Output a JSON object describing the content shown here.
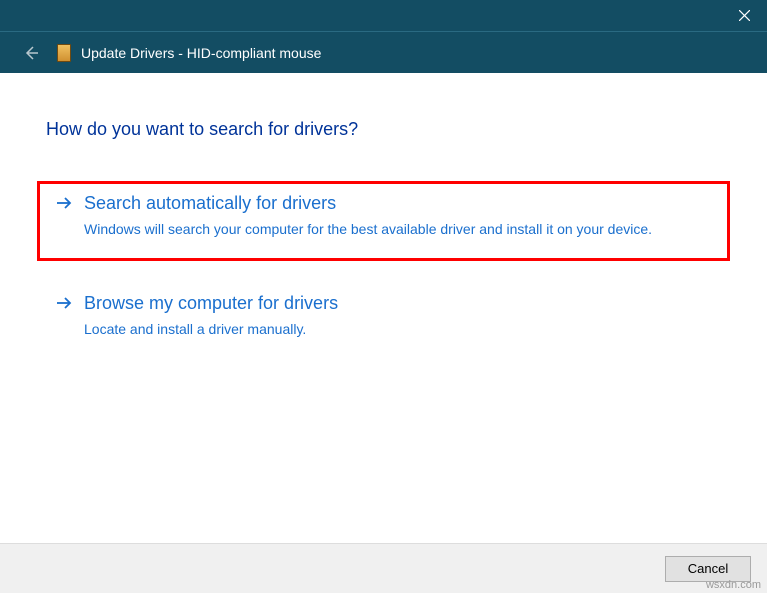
{
  "titlebar": {
    "close_label": "Close"
  },
  "header": {
    "title": "Update Drivers - HID-compliant mouse"
  },
  "heading": "How do you want to search for drivers?",
  "options": [
    {
      "title": "Search automatically for drivers",
      "desc": "Windows will search your computer for the best available driver and install it on your device."
    },
    {
      "title": "Browse my computer for drivers",
      "desc": "Locate and install a driver manually."
    }
  ],
  "footer": {
    "cancel_label": "Cancel"
  },
  "watermark": "wsxdn.com"
}
